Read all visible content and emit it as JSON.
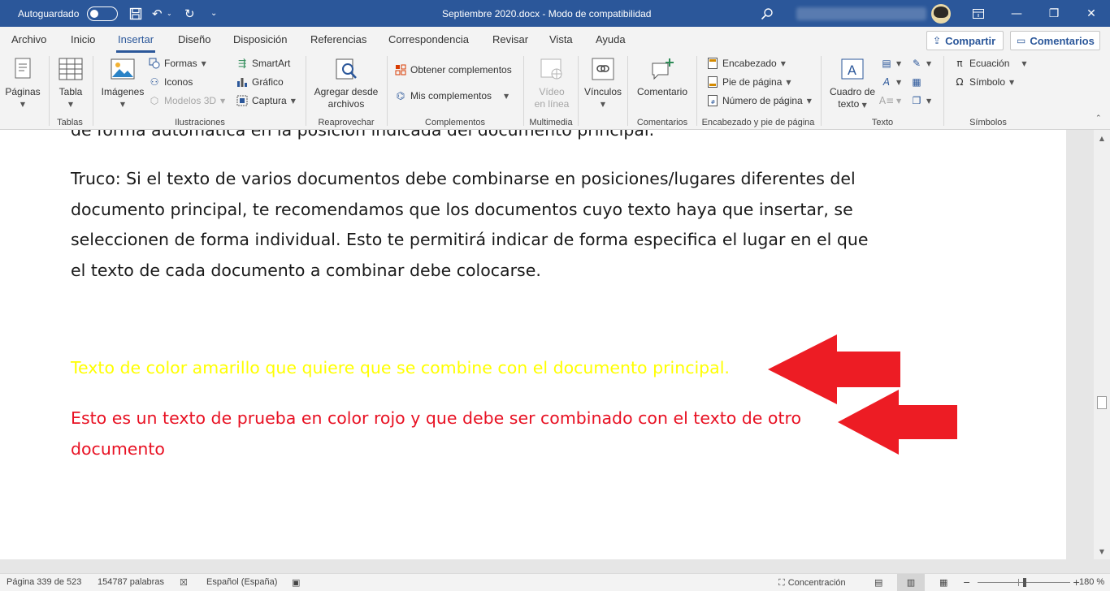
{
  "titlebar": {
    "autosave_label": "Autoguardado",
    "document_title": "Septiembre 2020.docx  -  Modo de compatibilidad",
    "bg_color": "#2b579a"
  },
  "menu": {
    "tabs": [
      "Archivo",
      "Inicio",
      "Insertar",
      "Diseño",
      "Disposición",
      "Referencias",
      "Correspondencia",
      "Revisar",
      "Vista",
      "Ayuda"
    ],
    "active_tab": "Insertar",
    "share_label": "Compartir",
    "comments_label": "Comentarios"
  },
  "ribbon": {
    "paginas": "Páginas",
    "tabla": "Tabla",
    "tablas_group": "Tablas",
    "imagenes": "Imágenes",
    "formas": "Formas",
    "iconos": "Iconos",
    "modelos3d": "Modelos 3D",
    "smartart": "SmartArt",
    "grafico": "Gráfico",
    "captura": "Captura",
    "ilustraciones_group": "Ilustraciones",
    "agregar_line1": "Agregar desde",
    "agregar_line2": "archivos",
    "reaprovechar_group": "Reaprovechar",
    "obtener_complementos": "Obtener complementos",
    "mis_complementos": "Mis complementos",
    "complementos_group": "Complementos",
    "video_line1": "Vídeo",
    "video_line2": "en línea",
    "multimedia_group": "Multimedia",
    "vinculos": "Vínculos",
    "comentario": "Comentario",
    "comentarios_group": "Comentarios",
    "encabezado": "Encabezado",
    "pie_de_pagina": "Pie de página",
    "numero_de_pagina": "Número de página",
    "encabezado_group": "Encabezado y pie de página",
    "cuadro_line1": "Cuadro de",
    "cuadro_line2": "texto",
    "texto_group": "Texto",
    "ecuacion": "Ecuación",
    "simbolo": "Símbolo",
    "simbolos_group": "Símbolos"
  },
  "document": {
    "cut_line": "de forma automática en la posición indicada del documento principal.",
    "trick_lines": [
      "Truco: Si el texto de varios documentos debe combinarse en posiciones/lugares diferentes del",
      "documento principal, te recomendamos que los documentos cuyo texto haya que insertar, se",
      "seleccionen de forma individual. Esto te permitirá indicar de forma especifica el lugar en el que",
      "el texto de cada documento a combinar debe colocarse."
    ],
    "yellow_text": "Texto de color amarillo que quiere que se combine con el documento principal.",
    "red_line1": "Esto es un texto de prueba en color rojo y que debe ser combinado con el texto de otro",
    "red_line2": "documento",
    "yellow_color": "#ffff00",
    "red_color": "#e81123",
    "arrow_color": "#ed1c24"
  },
  "status": {
    "page": "Página 339 de 523",
    "words": "154787 palabras",
    "language": "Español (España)",
    "focus": "Concentración",
    "zoom": "180 %"
  }
}
